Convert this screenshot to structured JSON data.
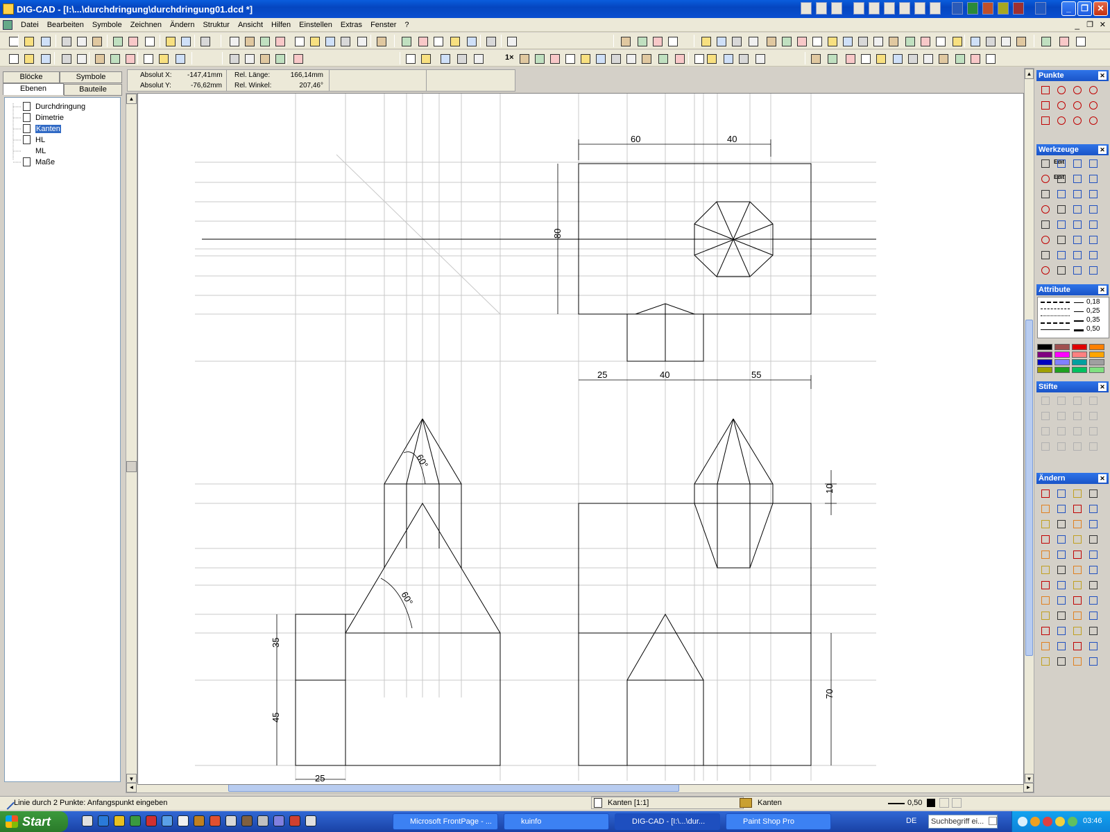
{
  "window": {
    "title": "DIG-CAD - [I:\\...\\durchdringung\\durchdringung01.dcd *]"
  },
  "menu": [
    "Datei",
    "Bearbeiten",
    "Symbole",
    "Zeichnen",
    "Ändern",
    "Struktur",
    "Ansicht",
    "Hilfen",
    "Einstellen",
    "Extras",
    "Fenster",
    "?"
  ],
  "left_tabs": {
    "row1": [
      "Blöcke",
      "Symbole"
    ],
    "row2": [
      "Ebenen",
      "Bauteile"
    ],
    "active": "Ebenen"
  },
  "layers": [
    {
      "name": "Durchdringung",
      "selected": false
    },
    {
      "name": "Dimetrie",
      "selected": false
    },
    {
      "name": "Kanten",
      "selected": true
    },
    {
      "name": "HL",
      "selected": false
    },
    {
      "name": "ML",
      "selected": false
    },
    {
      "name": "Maße",
      "selected": false
    }
  ],
  "coords": {
    "abs_x_label": "Absolut X:",
    "abs_x": "-147,41mm",
    "abs_y_label": "Absolut Y:",
    "abs_y": "-76,62mm",
    "rel_len_label": "Rel. Länge:",
    "rel_len": "166,14mm",
    "rel_ang_label": "Rel. Winkel:",
    "rel_ang": "207,46°"
  },
  "toolbar": {
    "zoom_1x": "1×"
  },
  "panels": {
    "punkte": "Punkte",
    "werkzeuge": "Werkzeuge",
    "attribute": "Attribute",
    "stifte": "Stifte",
    "aendern": "Ändern",
    "edit1": "Edit",
    "edit2": "Edit",
    "line_widths": [
      "0,18",
      "0,25",
      "0,35",
      "0,50"
    ],
    "color_swatches": [
      "#000000",
      "#a05050",
      "#e00000",
      "#ff8000",
      "#800080",
      "#ff00ff",
      "#ff8080",
      "#ffa500",
      "#0000c0",
      "#8080ff",
      "#00a0a0",
      "#a0a0a0",
      "#a0a000",
      "#20a020",
      "#00c060",
      "#80e080"
    ]
  },
  "drawing": {
    "dims": {
      "d60": "60",
      "d40a": "40",
      "d80": "80",
      "d25": "25",
      "d40b": "40",
      "d55": "55",
      "a60a": "60°",
      "a60b": "60°",
      "d35": "35",
      "d45": "45",
      "d25b": "25",
      "d10": "10",
      "d70": "70"
    }
  },
  "status": {
    "prompt": "Linie durch 2 Punkte: Anfangspunkt eingeben",
    "layer": "Kanten [1:1]",
    "layer2": "Kanten",
    "width": "0,50"
  },
  "taskbar": {
    "start": "Start",
    "tasks": [
      {
        "label": "Microsoft FrontPage - ...",
        "active": false
      },
      {
        "label": "kuinfo",
        "active": false
      },
      {
        "label": "DIG-CAD - [I:\\...\\dur...",
        "active": true
      },
      {
        "label": "Paint Shop Pro",
        "active": false
      }
    ],
    "lang": "DE",
    "search": "Suchbegriff ei...",
    "clock": "03:46"
  }
}
